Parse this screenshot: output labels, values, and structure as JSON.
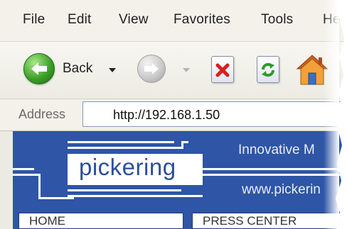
{
  "menu": {
    "items": [
      "File",
      "Edit",
      "View",
      "Favorites",
      "Tools",
      "Help"
    ]
  },
  "toolbar": {
    "back_label": "Back",
    "back_icon": "back-arrow-icon",
    "forward_icon": "forward-arrow-icon",
    "stop_icon": "stop-icon",
    "refresh_icon": "refresh-icon",
    "home_icon": "home-icon"
  },
  "address": {
    "label": "Address",
    "value": "http://192.168.1.50"
  },
  "page": {
    "logo_text": "pickering",
    "tagline": "Innovative M",
    "website": "www.pickerin",
    "nav": [
      "HOME",
      "PRESS CENTER"
    ]
  },
  "colors": {
    "banner_blue": "#2e55a6",
    "back_green": "#3ea12b",
    "stop_red": "#d62020",
    "refresh_green": "#2f9a2a",
    "home_orange": "#e8862a"
  }
}
